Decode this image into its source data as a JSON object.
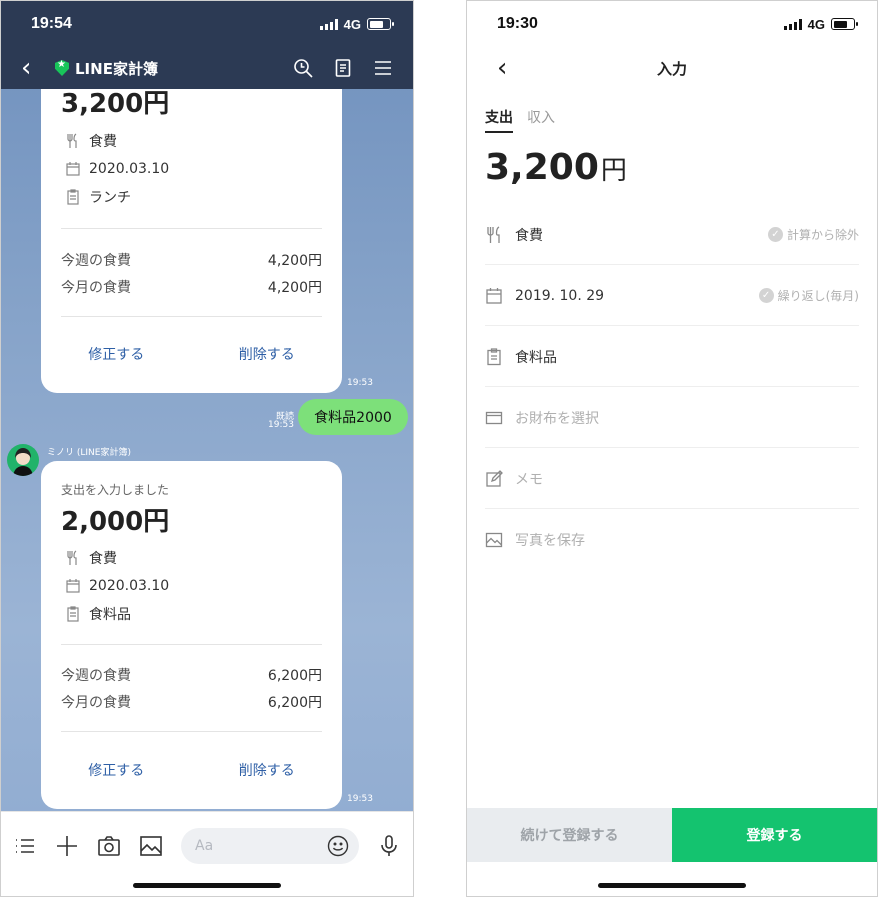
{
  "left": {
    "status": {
      "time": "19:54",
      "network": "4G"
    },
    "header": {
      "title": "LINE家計簿"
    },
    "card1": {
      "amount": "3,200円",
      "category": "食費",
      "date": "2020.03.10",
      "memo": "ランチ",
      "summary": [
        {
          "label": "今週の食費",
          "value": "4,200円"
        },
        {
          "label": "今月の食費",
          "value": "4,200円"
        }
      ],
      "edit_label": "修正する",
      "delete_label": "削除する",
      "time": "19:53"
    },
    "outgoing": {
      "read": "既読",
      "time": "19:53",
      "text": "食料品2000"
    },
    "sender": "ミノリ (LINE家計簿)",
    "card2": {
      "heading": "支出を入力しました",
      "amount": "2,000円",
      "category": "食費",
      "date": "2020.03.10",
      "memo": "食料品",
      "summary": [
        {
          "label": "今週の食費",
          "value": "6,200円"
        },
        {
          "label": "今月の食費",
          "value": "6,200円"
        }
      ],
      "edit_label": "修正する",
      "delete_label": "削除する",
      "time": "19:53"
    },
    "input_placeholder": "Aa"
  },
  "right": {
    "status": {
      "time": "19:30",
      "network": "4G"
    },
    "header": {
      "title": "入力"
    },
    "tabs": [
      {
        "label": "支出"
      },
      {
        "label": "収入"
      }
    ],
    "amount": {
      "number": "3,200",
      "unit": "円"
    },
    "rows": {
      "category": {
        "text": "食費",
        "option": "計算から除外"
      },
      "date": {
        "text": "2019. 10. 29",
        "option": "繰り返し(毎月)"
      },
      "memo": {
        "text": "食料品"
      },
      "wallet": {
        "text": "お財布を選択"
      },
      "note": {
        "text": "メモ"
      },
      "photo": {
        "text": "写真を保存"
      }
    },
    "footer": {
      "continue_label": "続けて登録する",
      "register_label": "登録する"
    }
  },
  "colors": {
    "line_green": "#14c36f",
    "header_navy": "#2c3a54",
    "bubble_green": "#7de07a",
    "link_blue": "#2e5fa6"
  }
}
